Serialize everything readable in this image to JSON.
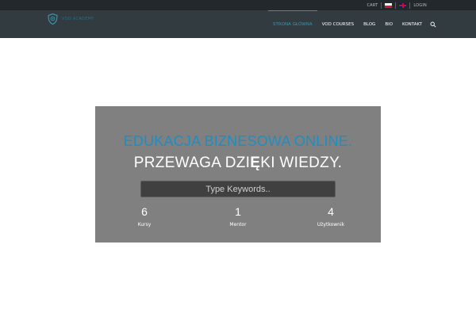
{
  "topbar": {
    "cart_label": "CART",
    "login_label": "LOGIN",
    "languages": [
      "pl-flag",
      "uk-flag"
    ]
  },
  "logo": {
    "icon": "shield-logo-icon",
    "text": "VOD ACADEMY"
  },
  "nav": {
    "items": [
      {
        "label": "STRONA GŁÓWNA",
        "active": true
      },
      {
        "label": "VOD COURSES",
        "active": false
      },
      {
        "label": "BLOG",
        "active": false
      },
      {
        "label": "BIO",
        "active": false
      },
      {
        "label": "KONTAKT",
        "active": false
      }
    ],
    "search_icon": "search-icon"
  },
  "hero": {
    "title_line1": "EDUKACJA BIZNESOWA ONLINE.",
    "title_line2_before": "PRZEWAGA DZI",
    "title_line2_bold": "Ę",
    "title_line2_after": "KI WIEDZY.",
    "search_placeholder": "Type Keywords..",
    "stats": [
      {
        "value": "6",
        "label": "Kursy"
      },
      {
        "value": "1",
        "label": "Mentor"
      },
      {
        "value": "4",
        "label": "Użytkownik"
      }
    ]
  },
  "colors": {
    "topbar_bg": "#22282b",
    "navbar_bg": "#323b40",
    "accent": "#3a93ae",
    "hero_bg": "#808080",
    "hero_title_blue": "#1b8fc4"
  }
}
